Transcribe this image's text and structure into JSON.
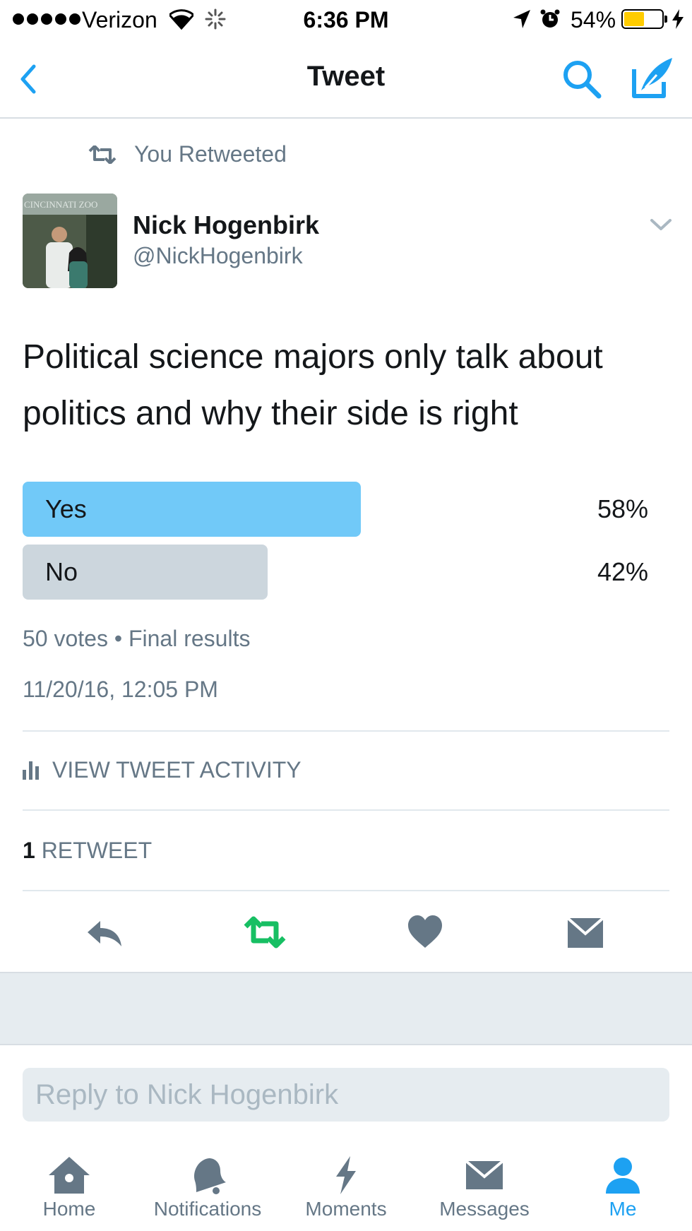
{
  "status_bar": {
    "carrier": "Verizon",
    "time": "6:36 PM",
    "battery": "54%",
    "battery_level": 0.54
  },
  "nav": {
    "title": "Tweet",
    "icons": [
      "back-chevron-icon",
      "search-icon",
      "compose-tweet-icon"
    ]
  },
  "retweet_header": {
    "icon": "retweet-icon",
    "text": "You Retweeted"
  },
  "author": {
    "name": "Nick Hogenbirk",
    "handle": "@NickHogenbirk",
    "avatar_text": "CINCINNATI ZOO"
  },
  "tweet": {
    "text": "Political science majors only talk about politics and why their side is right",
    "timestamp": "11/20/16, 12:05 PM"
  },
  "poll": {
    "options": [
      {
        "label": "Yes",
        "percent": "58%",
        "value": 58,
        "color": "#71c9f8"
      },
      {
        "label": "No",
        "percent": "42%",
        "value": 42,
        "color": "#ccd6dd"
      }
    ],
    "votes": "50 votes",
    "separator": "•",
    "status": "Final results"
  },
  "activity": {
    "label": "VIEW TWEET ACTIVITY",
    "icon": "bar-chart-icon"
  },
  "retweets": {
    "count": "1",
    "label": "RETWEET"
  },
  "actions": [
    "reply-icon",
    "retweet-icon",
    "like-icon",
    "direct-message-icon"
  ],
  "reply": {
    "placeholder": "Reply to Nick Hogenbirk"
  },
  "tabs": [
    {
      "label": "Home",
      "icon": "home-icon",
      "active": false
    },
    {
      "label": "Notifications",
      "icon": "bell-icon",
      "active": false
    },
    {
      "label": "Moments",
      "icon": "lightning-icon",
      "active": false
    },
    {
      "label": "Messages",
      "icon": "envelope-icon",
      "active": false
    },
    {
      "label": "Me",
      "icon": "person-icon",
      "active": true
    }
  ],
  "colors": {
    "accent": "#1da1f2",
    "retweet_green": "#17bf63",
    "secondary_text": "#657786",
    "battery": "#ffcc00"
  }
}
